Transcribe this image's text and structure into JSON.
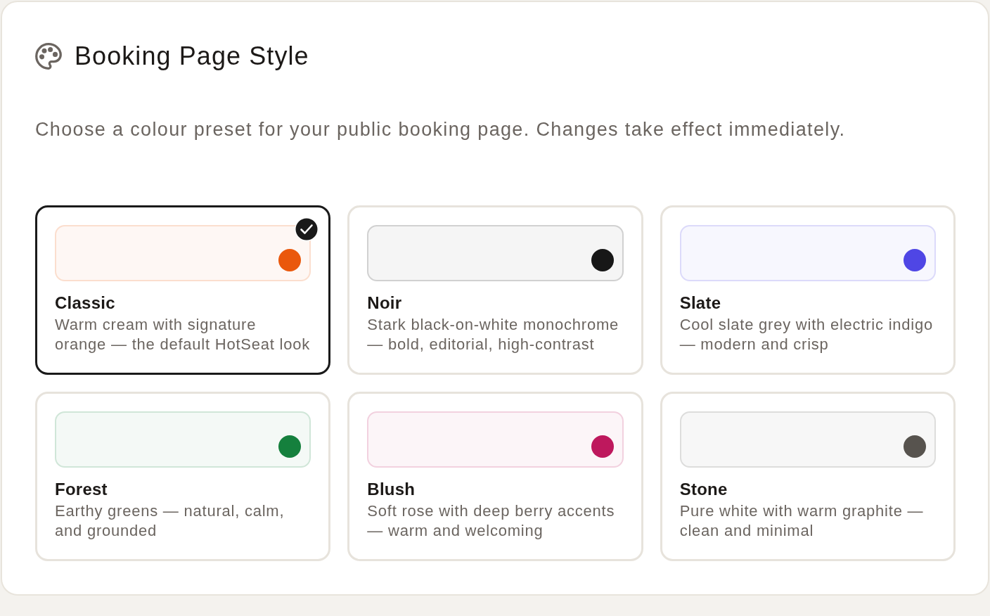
{
  "title": "Booking Page Style",
  "description": "Choose a colour preset for your public booking page. Changes take effect immediately.",
  "presets": [
    {
      "name": "Classic",
      "description": "Warm cream with signature orange — the default HotSeat look",
      "selected": true,
      "color": "#ea580c"
    },
    {
      "name": "Noir",
      "description": "Stark black-on-white monochrome — bold, editorial, high-contrast",
      "selected": false,
      "color": "#171717"
    },
    {
      "name": "Slate",
      "description": "Cool slate grey with electric indigo — modern and crisp",
      "selected": false,
      "color": "#4f46e5"
    },
    {
      "name": "Forest",
      "description": "Earthy greens — natural, calm, and grounded",
      "selected": false,
      "color": "#15803d"
    },
    {
      "name": "Blush",
      "description": "Soft rose with deep berry accents — warm and welcoming",
      "selected": false,
      "color": "#be185d"
    },
    {
      "name": "Stone",
      "description": "Pure white with warm graphite — clean and minimal",
      "selected": false,
      "color": "#57534e"
    }
  ]
}
